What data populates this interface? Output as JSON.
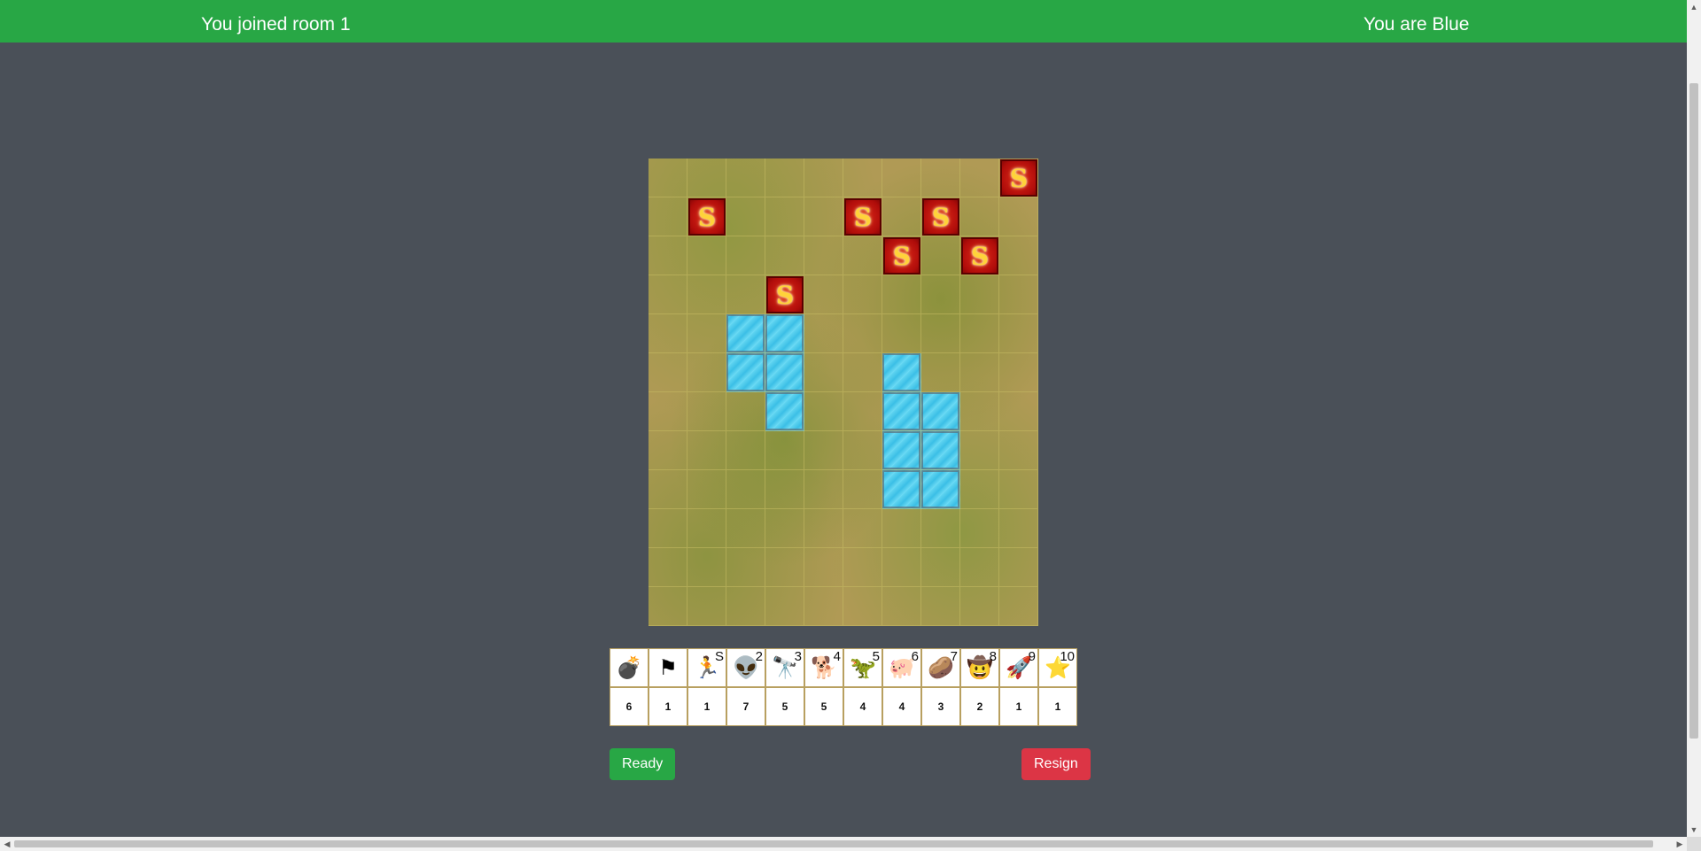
{
  "header": {
    "room_status": "You joined room 1",
    "player_color": "You are Blue"
  },
  "board": {
    "columns": 10,
    "rows": 12,
    "water_cells": [
      [
        4,
        2
      ],
      [
        4,
        3
      ],
      [
        5,
        2
      ],
      [
        5,
        3
      ],
      [
        6,
        3
      ],
      [
        5,
        6
      ],
      [
        6,
        6
      ],
      [
        6,
        7
      ],
      [
        7,
        6
      ],
      [
        7,
        7
      ],
      [
        8,
        6
      ],
      [
        8,
        7
      ]
    ],
    "opponent_pieces": [
      [
        0,
        9
      ],
      [
        1,
        1
      ],
      [
        1,
        5
      ],
      [
        1,
        7
      ],
      [
        2,
        6
      ],
      [
        2,
        8
      ],
      [
        3,
        3
      ]
    ],
    "opponent_piece_symbol": "S"
  },
  "tray": {
    "pieces": [
      {
        "name": "bomb-icon",
        "symbol": "💣",
        "rank": "",
        "count": "6"
      },
      {
        "name": "flag-icon",
        "symbol": "⚑",
        "rank": "",
        "count": "1"
      },
      {
        "name": "spy-icon",
        "symbol": "🏃",
        "rank": "S",
        "count": "1"
      },
      {
        "name": "alien-icon",
        "symbol": "👽",
        "rank": "2",
        "count": "7"
      },
      {
        "name": "binoculars-icon",
        "symbol": "🔭",
        "rank": "3",
        "count": "5"
      },
      {
        "name": "dog-icon",
        "symbol": "🐕",
        "rank": "4",
        "count": "5"
      },
      {
        "name": "dinosaur-icon",
        "symbol": "🦖",
        "rank": "5",
        "count": "4"
      },
      {
        "name": "pig-icon",
        "symbol": "🐖",
        "rank": "6",
        "count": "4"
      },
      {
        "name": "potato-icon",
        "symbol": "🥔",
        "rank": "7",
        "count": "3"
      },
      {
        "name": "cowgirl-icon",
        "symbol": "🤠",
        "rank": "8",
        "count": "2"
      },
      {
        "name": "astronaut-icon",
        "symbol": "🚀",
        "rank": "9",
        "count": "1"
      },
      {
        "name": "sheriff-icon",
        "symbol": "⭐",
        "rank": "10",
        "count": "1"
      }
    ]
  },
  "buttons": {
    "ready": "Ready",
    "resign": "Resign"
  },
  "colors": {
    "header": "#28a745",
    "background": "#4a5058",
    "ready": "#28a745",
    "resign": "#dc3545",
    "opponent_piece": "#c81810"
  }
}
